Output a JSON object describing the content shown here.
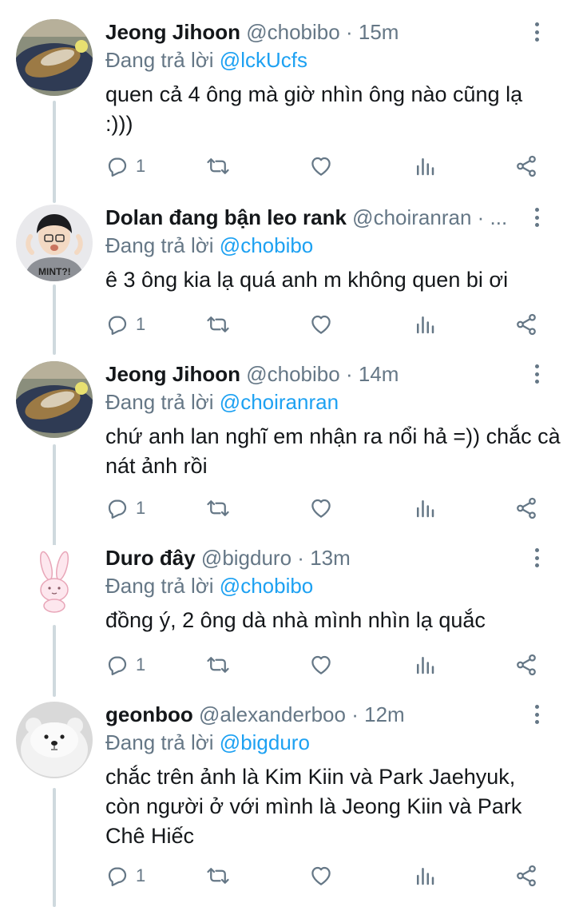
{
  "tweets": [
    {
      "display_name": "Jeong Jihoon",
      "handle": "@chobibo",
      "separator": "·",
      "time": "15m",
      "reply_prefix": "Đang trả lời",
      "reply_mention": "@lckUcfs",
      "text": "quen cả 4 ông mà giờ nhìn ông nào cũng lạ :)))",
      "reply_count": "1",
      "avatar": "grilled-fish-photo"
    },
    {
      "display_name": "Dolan đang bận leo rank",
      "handle": "@choiranran",
      "separator": "· ...",
      "time": "",
      "reply_prefix": "Đang trả lời",
      "reply_mention": "@chobibo",
      "text": "ê 3 ông kia lạ quá anh m không quen bi ơi",
      "reply_count": "1",
      "avatar": "person-photo"
    },
    {
      "display_name": "Jeong Jihoon",
      "handle": "@chobibo",
      "separator": "·",
      "time": "14m",
      "reply_prefix": "Đang trả lời",
      "reply_mention": "@choiranran",
      "text": "chứ anh lan nghĩ em nhận ra nổi hả =)) chắc cà nát ảnh rồi",
      "reply_count": "1",
      "avatar": "grilled-fish-photo"
    },
    {
      "display_name": "Duro đây",
      "handle": "@bigduro",
      "separator": "·",
      "time": "13m",
      "reply_prefix": "Đang trả lời",
      "reply_mention": "@chobibo",
      "text": "đồng ý, 2 ông dà nhà mình nhìn lạ quắc",
      "reply_count": "1",
      "avatar": "pink-bunny-icon"
    },
    {
      "display_name": "geonboo",
      "handle": "@alexanderboo",
      "separator": "·",
      "time": "12m",
      "reply_prefix": "Đang trả lời",
      "reply_mention": "@bigduro",
      "text": "chắc trên ảnh là Kim Kiin và Park Jaehyuk, còn người ở với mình là Jeong Kiin và Park Chê Hiếc",
      "reply_count": "1",
      "avatar": "white-bear-plush-photo"
    }
  ],
  "colors": {
    "accent": "#1da1f2",
    "secondary_text": "#657786",
    "thread_line": "#cfd9de"
  },
  "icons": [
    "reply-icon",
    "retweet-icon",
    "like-icon",
    "stats-icon",
    "share-icon",
    "more-options-icon"
  ]
}
